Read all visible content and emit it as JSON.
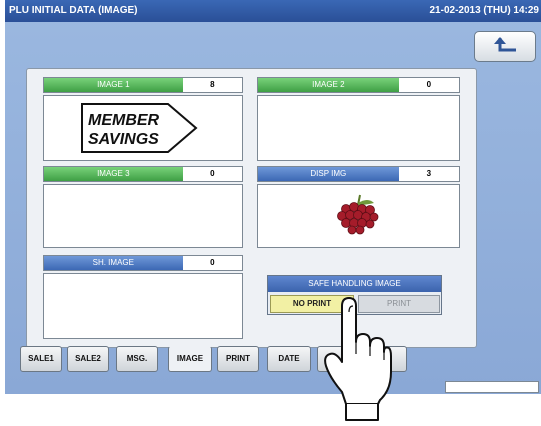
{
  "titlebar": {
    "title": "PLU INITIAL DATA (IMAGE)",
    "datetime": "21-02-2013 (THU) 14:29"
  },
  "back_button": {
    "icon": "return-arrow-icon"
  },
  "images": {
    "image1": {
      "label": "IMAGE 1",
      "value": "8",
      "content_text": [
        "MEMBER",
        "SAVINGS"
      ]
    },
    "image2": {
      "label": "IMAGE 2",
      "value": "0"
    },
    "image3": {
      "label": "IMAGE 3",
      "value": "0"
    },
    "disp_img": {
      "label": "DISP IMG",
      "value": "3",
      "icon": "grapes-icon"
    },
    "sh_image": {
      "label": "SH. IMAGE",
      "value": "0"
    }
  },
  "safe_handling": {
    "title": "SAFE HANDLING IMAGE",
    "no_print": "NO PRINT",
    "print": "PRINT",
    "selected": "NO PRINT"
  },
  "tabs": [
    {
      "label": "SALE1"
    },
    {
      "label": "SALE2"
    },
    {
      "label": "MSG."
    },
    {
      "label": "IMAGE"
    },
    {
      "label": "PRINT"
    },
    {
      "label": "DATE"
    },
    {
      "label": "CO"
    }
  ],
  "active_tab": "IMAGE",
  "colors": {
    "header_green": "#4fb355",
    "header_blue": "#4a77c2",
    "background": "#8eabd8",
    "selected_option": "#f2f0a4"
  },
  "overlay": {
    "icon": "pointing-hand-icon"
  }
}
